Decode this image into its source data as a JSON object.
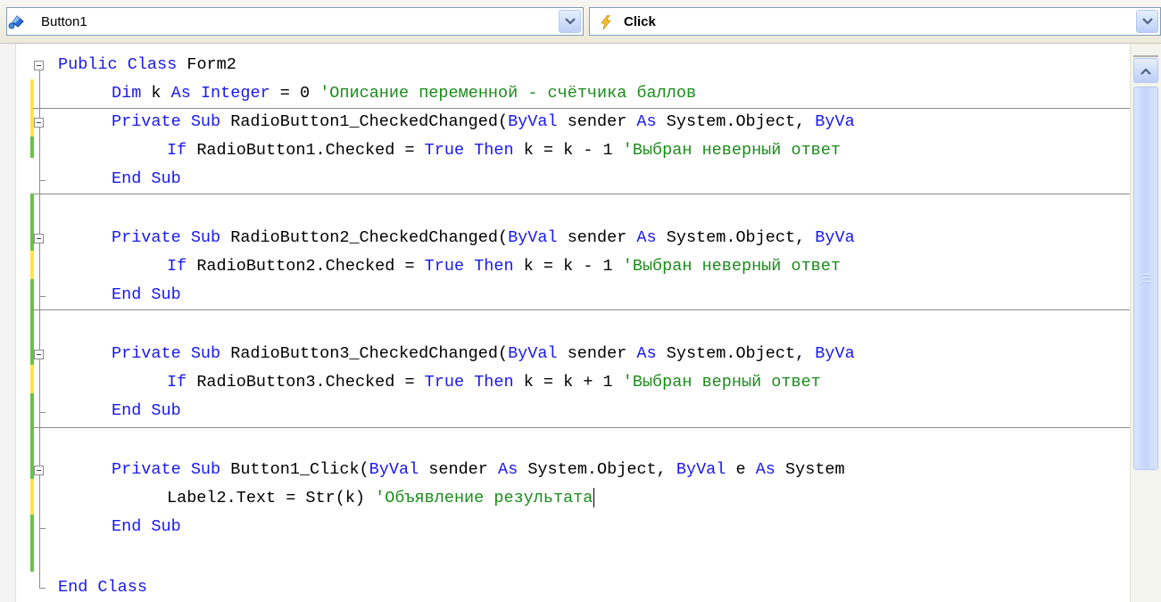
{
  "navbar": {
    "object_combo": {
      "icon": "control-object-icon",
      "value": "Button1"
    },
    "event_combo": {
      "icon": "lightning-event-icon",
      "value": "Click"
    }
  },
  "editor": {
    "lines": [
      {
        "tokens": [
          {
            "t": "Public Class",
            "k": "kw"
          },
          {
            "t": " Form2",
            "k": "pl"
          }
        ]
      },
      {
        "tokens": [
          {
            "t": "Dim",
            "k": "kw"
          },
          {
            "t": " k ",
            "k": "pl"
          },
          {
            "t": "As",
            "k": "kw"
          },
          {
            "t": " ",
            "k": "pl"
          },
          {
            "t": "Integer",
            "k": "kw"
          },
          {
            "t": " = 0 ",
            "k": "pl"
          },
          {
            "t": "'Описание переменной - счётчика баллов",
            "k": "cm"
          }
        ]
      },
      {
        "tokens": [
          {
            "t": "Private Sub",
            "k": "kw"
          },
          {
            "t": " RadioButton1_CheckedChanged(",
            "k": "pl"
          },
          {
            "t": "ByVal",
            "k": "kw"
          },
          {
            "t": " sender ",
            "k": "pl"
          },
          {
            "t": "As",
            "k": "kw"
          },
          {
            "t": " System.Object, ",
            "k": "pl"
          },
          {
            "t": "ByVa",
            "k": "kw"
          }
        ]
      },
      {
        "tokens": [
          {
            "t": "If",
            "k": "kw"
          },
          {
            "t": " RadioButton1.Checked = ",
            "k": "pl"
          },
          {
            "t": "True",
            "k": "kw"
          },
          {
            "t": " ",
            "k": "pl"
          },
          {
            "t": "Then",
            "k": "kw"
          },
          {
            "t": " k = k - 1 ",
            "k": "pl"
          },
          {
            "t": "'Выбран неверный ответ",
            "k": "cm"
          }
        ]
      },
      {
        "tokens": [
          {
            "t": "End Sub",
            "k": "kw"
          }
        ]
      },
      {
        "tokens": []
      },
      {
        "tokens": [
          {
            "t": "Private Sub",
            "k": "kw"
          },
          {
            "t": " RadioButton2_CheckedChanged(",
            "k": "pl"
          },
          {
            "t": "ByVal",
            "k": "kw"
          },
          {
            "t": " sender ",
            "k": "pl"
          },
          {
            "t": "As",
            "k": "kw"
          },
          {
            "t": " System.Object, ",
            "k": "pl"
          },
          {
            "t": "ByVa",
            "k": "kw"
          }
        ]
      },
      {
        "tokens": [
          {
            "t": "If",
            "k": "kw"
          },
          {
            "t": " RadioButton2.Checked = ",
            "k": "pl"
          },
          {
            "t": "True",
            "k": "kw"
          },
          {
            "t": " ",
            "k": "pl"
          },
          {
            "t": "Then",
            "k": "kw"
          },
          {
            "t": " k = k - 1 ",
            "k": "pl"
          },
          {
            "t": "'Выбран неверный ответ",
            "k": "cm"
          }
        ]
      },
      {
        "tokens": [
          {
            "t": "End Sub",
            "k": "kw"
          }
        ]
      },
      {
        "tokens": []
      },
      {
        "tokens": [
          {
            "t": "Private Sub",
            "k": "kw"
          },
          {
            "t": " RadioButton3_CheckedChanged(",
            "k": "pl"
          },
          {
            "t": "ByVal",
            "k": "kw"
          },
          {
            "t": " sender ",
            "k": "pl"
          },
          {
            "t": "As",
            "k": "kw"
          },
          {
            "t": " System.Object, ",
            "k": "pl"
          },
          {
            "t": "ByVa",
            "k": "kw"
          }
        ]
      },
      {
        "tokens": [
          {
            "t": "If",
            "k": "kw"
          },
          {
            "t": " RadioButton3.Checked = ",
            "k": "pl"
          },
          {
            "t": "True",
            "k": "kw"
          },
          {
            "t": " ",
            "k": "pl"
          },
          {
            "t": "Then",
            "k": "kw"
          },
          {
            "t": " k = k + 1 ",
            "k": "pl"
          },
          {
            "t": "'Выбран верный ответ",
            "k": "cm"
          }
        ]
      },
      {
        "tokens": [
          {
            "t": "End Sub",
            "k": "kw"
          }
        ]
      },
      {
        "tokens": []
      },
      {
        "tokens": [
          {
            "t": "Private Sub",
            "k": "kw"
          },
          {
            "t": " Button1_Click(",
            "k": "pl"
          },
          {
            "t": "ByVal",
            "k": "kw"
          },
          {
            "t": " sender ",
            "k": "pl"
          },
          {
            "t": "As",
            "k": "kw"
          },
          {
            "t": " System.Object, ",
            "k": "pl"
          },
          {
            "t": "ByVal",
            "k": "kw"
          },
          {
            "t": " e ",
            "k": "pl"
          },
          {
            "t": "As",
            "k": "kw"
          },
          {
            "t": " System",
            "k": "pl"
          }
        ]
      },
      {
        "tokens": [
          {
            "t": "Label2.Text = Str(k) ",
            "k": "pl"
          },
          {
            "t": "'Объявление результата",
            "k": "cm"
          }
        ],
        "caret": true
      },
      {
        "tokens": [
          {
            "t": "End Sub",
            "k": "kw"
          }
        ]
      },
      {
        "tokens": []
      },
      {
        "tokens": [
          {
            "t": "End Class",
            "k": "kw"
          }
        ]
      }
    ]
  },
  "colors": {
    "keyword": "#1818f0",
    "comment": "#1a8c1a",
    "text": "#000000",
    "saved_change": "#6cc04a",
    "unsaved_change": "#ffe34a"
  }
}
